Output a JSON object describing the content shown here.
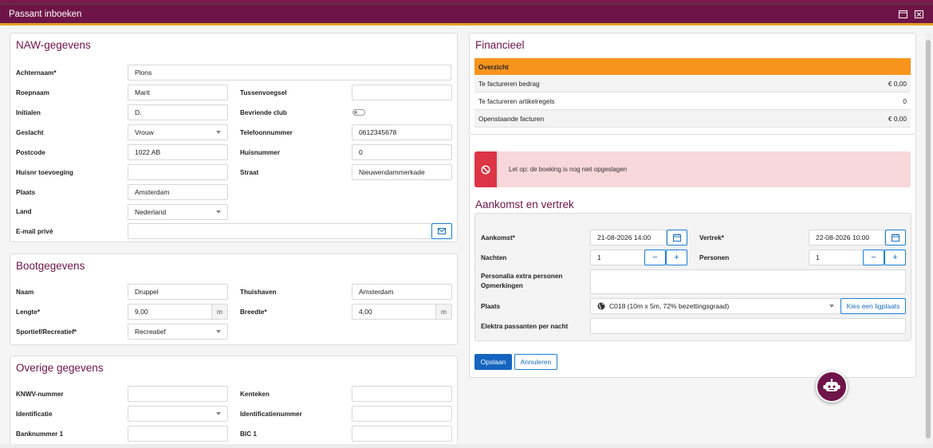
{
  "window": {
    "title": "Passant inboeken"
  },
  "naw": {
    "title": "NAW-gegevens",
    "achternaam": {
      "label": "Achternaam*",
      "value": "Plons"
    },
    "roepnaam": {
      "label": "Roepnaam",
      "value": "Marit"
    },
    "tussenvoegsel": {
      "label": "Tussenvoegsel",
      "value": ""
    },
    "initialen": {
      "label": "Initialen",
      "value": "D."
    },
    "bevriende_club": {
      "label": "Bevriende club"
    },
    "geslacht": {
      "label": "Geslacht",
      "value": "Vrouw"
    },
    "telefoon": {
      "label": "Telefoonnummer",
      "value": "0612345678"
    },
    "postcode": {
      "label": "Postcode",
      "value": "1022 AB"
    },
    "huisnummer": {
      "label": "Huisnummer",
      "value": "0"
    },
    "huisnr_toev": {
      "label": "Huisnr toevoeging",
      "value": ""
    },
    "straat": {
      "label": "Straat",
      "value": "Nieuwendammerkade"
    },
    "plaats": {
      "label": "Plaats",
      "value": "Amsterdam"
    },
    "land": {
      "label": "Land",
      "value": "Nederland"
    },
    "email": {
      "label": "E-mail privé",
      "value": ""
    }
  },
  "boot": {
    "title": "Bootgegevens",
    "naam": {
      "label": "Naam",
      "value": "Druppel"
    },
    "thuishaven": {
      "label": "Thuishaven",
      "value": "Amsterdam"
    },
    "lengte": {
      "label": "Lengte*",
      "value": "9,00",
      "unit": "m"
    },
    "breedte": {
      "label": "Breedte*",
      "value": "4,00",
      "unit": "m"
    },
    "sportief": {
      "label": "Sportief/Recreatief*",
      "value": "Recreatief"
    }
  },
  "overig": {
    "title": "Overige gegevens",
    "knwv": {
      "label": "KNWV-nummer",
      "value": ""
    },
    "kenteken": {
      "label": "Kenteken",
      "value": ""
    },
    "identificatie": {
      "label": "Identificatie",
      "value": ""
    },
    "identificatienummer": {
      "label": "Identificatienummer",
      "value": ""
    },
    "banknummer": {
      "label": "Banknummer 1",
      "value": ""
    },
    "bic": {
      "label": "BIC 1",
      "value": ""
    }
  },
  "financieel": {
    "title": "Financieel",
    "header": "Overzicht",
    "rows": [
      {
        "label": "Te factureren bedrag",
        "value": "€ 0,00"
      },
      {
        "label": "Te factureren artikelregels",
        "value": "0"
      },
      {
        "label": "Openstaande facturen",
        "value": "€ 0,00"
      }
    ]
  },
  "alert": {
    "text": "Let op: de boeking is nog niet opgeslagen"
  },
  "aankomst": {
    "title": "Aankomst en vertrek",
    "aankomst": {
      "label": "Aankomst*",
      "value": "21-08-2026 14:00"
    },
    "vertrek": {
      "label": "Vertrek*",
      "value": "22-08-2026 10:00"
    },
    "nachten": {
      "label": "Nachten",
      "value": "1"
    },
    "personen": {
      "label": "Personen",
      "value": "1"
    },
    "personalia": {
      "label": "Personalia extra personen Opmerkingen",
      "value": ""
    },
    "plaats": {
      "label": "Plaats",
      "value": "C018 (10m x 5m, 72% bezettingsgraad)"
    },
    "kies_button": "Kies een ligplaats",
    "elektra": {
      "label": "Elektra passanten per nacht",
      "value": ""
    },
    "minus": "−",
    "plus": "+"
  },
  "actions": {
    "save": "Opslaan",
    "cancel": "Annuleren"
  },
  "colors": {
    "brand": "#6e1448",
    "accent": "#f7941d",
    "primary": "#1565c0",
    "danger": "#dc3545"
  }
}
